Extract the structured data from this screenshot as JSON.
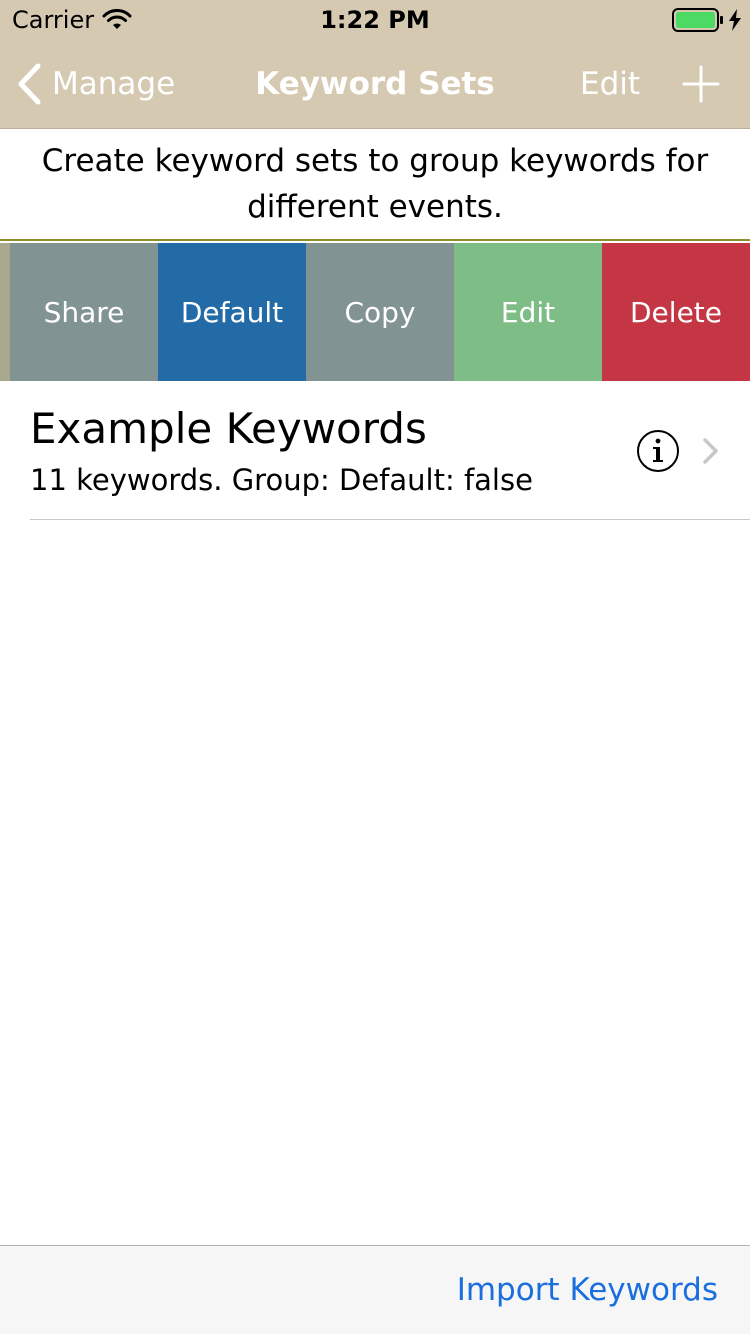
{
  "status_bar": {
    "carrier": "Carrier",
    "time": "1:22 PM",
    "battery_color": "#4cd964"
  },
  "nav": {
    "back_label": "Manage",
    "title": "Keyword Sets",
    "edit_label": "Edit"
  },
  "description": "Create keyword sets to group keywords for different events.",
  "actions": {
    "share": "Share",
    "default": "Default",
    "copy": "Copy",
    "edit": "Edit",
    "delete": "Delete"
  },
  "item": {
    "title": "Example Keywords",
    "subtitle": "11 keywords. Group:  Default: false"
  },
  "toolbar": {
    "import_label": "Import Keywords"
  },
  "colors": {
    "nav_background": "#d5c9b2",
    "share": "#829393",
    "default": "#236ba7",
    "copy": "#829393",
    "edit": "#7fbd87",
    "delete": "#c43643",
    "link": "#1a6ede"
  }
}
